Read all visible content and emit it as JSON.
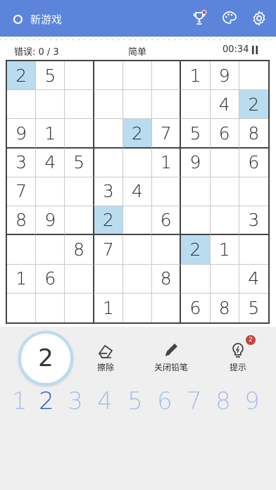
{
  "header": {
    "new_game_label": "新游戏",
    "trophy_icon": "trophy-icon",
    "palette_icon": "palette-icon",
    "settings_icon": "gear-icon"
  },
  "info": {
    "errors": "错误: 0 / 3",
    "difficulty": "简单",
    "timer": "00:34"
  },
  "board": {
    "rows": [
      [
        "2",
        "5",
        "",
        "",
        "",
        "",
        "1",
        "9",
        ""
      ],
      [
        "",
        "",
        "",
        "",
        "",
        "",
        "",
        "4",
        "2"
      ],
      [
        "9",
        "1",
        "",
        "",
        "2",
        "7",
        "5",
        "6",
        "8"
      ],
      [
        "3",
        "4",
        "5",
        "",
        "",
        "1",
        "9",
        "",
        "6"
      ],
      [
        "7",
        "",
        "",
        "3",
        "4",
        "",
        "",
        "",
        ""
      ],
      [
        "8",
        "9",
        "",
        "2",
        "",
        "6",
        "",
        "",
        "3"
      ],
      [
        "",
        "",
        "8",
        "7",
        "",
        "",
        "2",
        "1",
        ""
      ],
      [
        "1",
        "6",
        "",
        "",
        "",
        "8",
        "",
        "",
        "4"
      ],
      [
        "",
        "",
        "",
        "1",
        "",
        "",
        "6",
        "8",
        "5"
      ]
    ],
    "highlighted": [
      [
        0,
        0
      ],
      [
        1,
        8
      ],
      [
        2,
        4
      ],
      [
        5,
        3
      ],
      [
        6,
        6
      ]
    ]
  },
  "controls": {
    "selected_number": "2",
    "erase_label": "擦除",
    "pencil_label": "关闭铅笔",
    "hint_label": "提示",
    "hint_count": "2"
  },
  "numpad": [
    "1",
    "2",
    "3",
    "4",
    "5",
    "6",
    "7",
    "8",
    "9"
  ],
  "numpad_active": "2",
  "colors": {
    "header": "#5b84da",
    "highlight": "#b9dcef",
    "numpad": "#a9bde5",
    "numpad_active": "#2d5cbf",
    "badge": "#c0463f"
  }
}
